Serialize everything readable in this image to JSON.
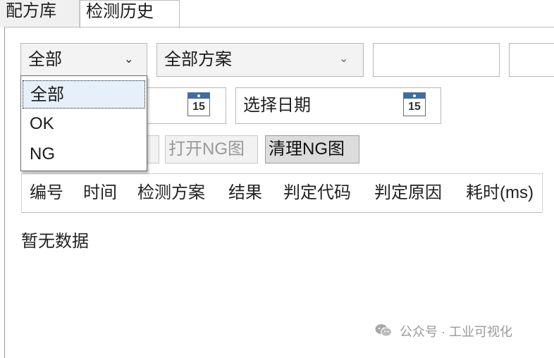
{
  "tabs": [
    {
      "label": "配方库",
      "active": false
    },
    {
      "label": "检测历史",
      "active": true
    }
  ],
  "filters": {
    "result_select": {
      "value": "全部"
    },
    "scheme_select": {
      "value": "全部方案"
    },
    "input_1": {
      "value": ""
    },
    "input_2": {
      "value": ""
    }
  },
  "date_range": {
    "start": {
      "value": "",
      "calendar_day": "15"
    },
    "end": {
      "placeholder": "选择日期",
      "calendar_day": "15"
    }
  },
  "buttons": {
    "partial_label": "/",
    "open_ng_label": "打开NG图",
    "clear_ng_label": "清理NG图"
  },
  "table": {
    "columns": [
      "编号",
      "时间",
      "检测方案",
      "结果",
      "判定代码",
      "判定原因",
      "耗时(ms)"
    ],
    "empty_text": "暂无数据"
  },
  "dropdown": {
    "options": [
      "全部",
      "OK",
      "NG"
    ],
    "selected": "全部"
  },
  "watermark": {
    "text": "公众号 · 工业可视化"
  }
}
